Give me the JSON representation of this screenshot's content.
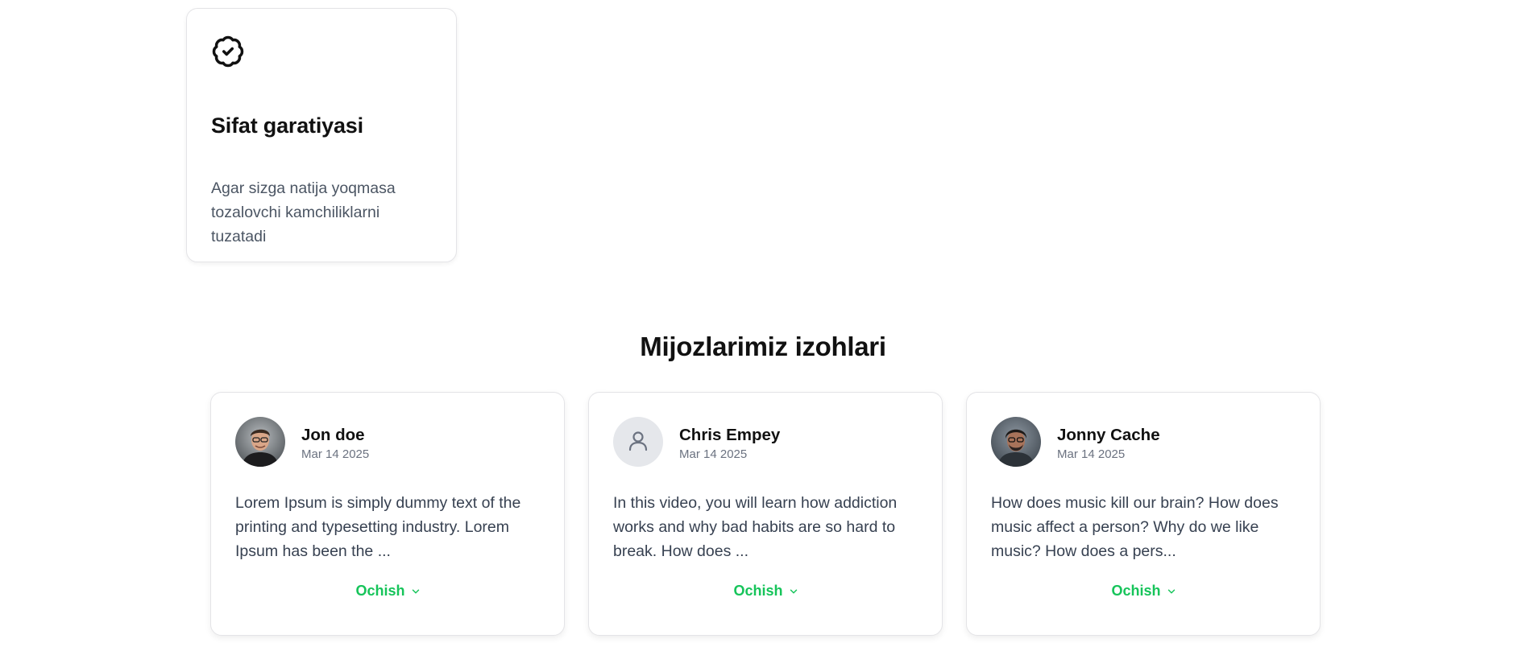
{
  "feature": {
    "icon": "badge-check-icon",
    "title": "Sifat garatiyasi",
    "description": "Agar sizga natija yoqmasa tozalovchi kamchiliklarni tuzatadi"
  },
  "testimonials": {
    "title": "Mijozlarimiz izohlari",
    "items": [
      {
        "name": "Jon doe",
        "date": "Mar 14 2025",
        "avatar": "photo-avatar",
        "text": "Lorem Ipsum is simply dummy text of the printing and typesetting industry. Lorem Ipsum has been the ...",
        "expand_label": "Ochish"
      },
      {
        "name": "Chris Empey",
        "date": "Mar 14 2025",
        "avatar": "default-user-icon",
        "text": "In this video, you will learn how addiction works and why bad habits are so hard to break. How does ...",
        "expand_label": "Ochish"
      },
      {
        "name": "Jonny Cache",
        "date": "Mar 14 2025",
        "avatar": "photo-avatar",
        "text": "How does music kill our brain? How does music affect a person? Why do we like music? How does a pers...",
        "expand_label": "Ochish"
      }
    ]
  },
  "colors": {
    "accent": "#16c45a",
    "text_muted": "#6b7280",
    "border": "#e4e4e7"
  }
}
